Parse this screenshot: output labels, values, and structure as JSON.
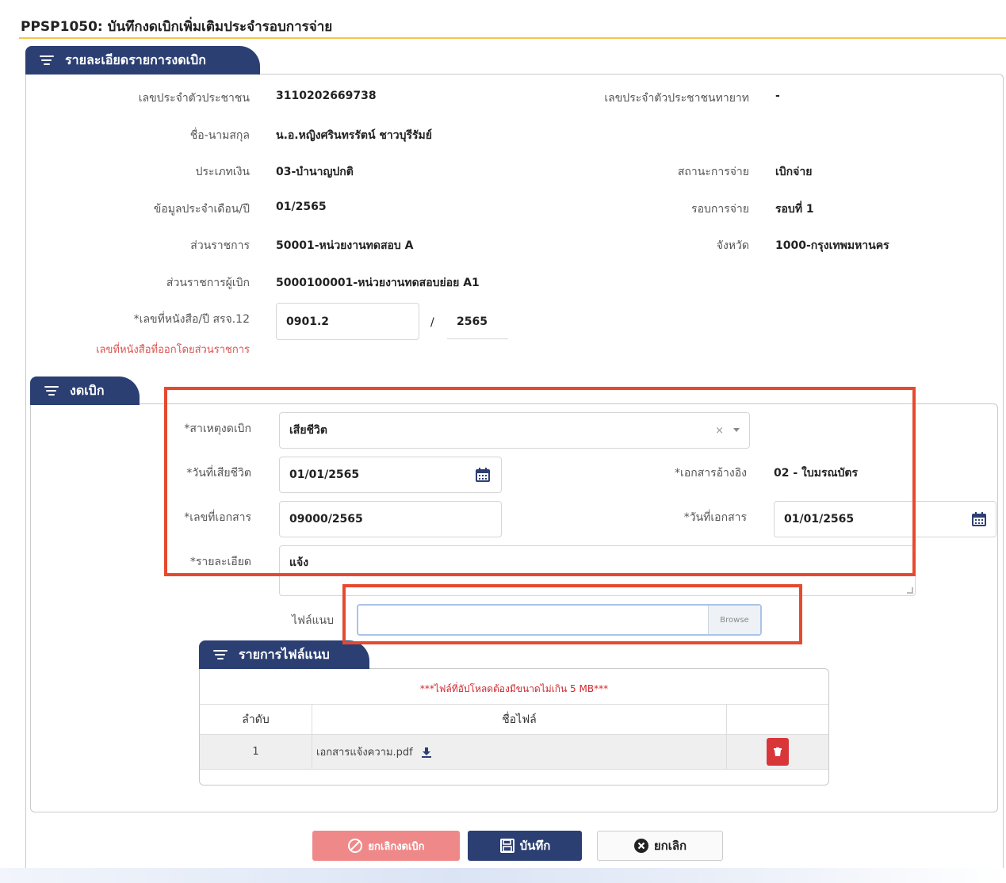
{
  "page": {
    "title": "PPSP1050: บันทึกงดเบิกเพิ่มเติมประจำรอบการจ่าย"
  },
  "details_panel": {
    "tab_label": "รายละเอียดรายการงดเบิก",
    "fields": {
      "citizen_id": {
        "label": "เลขประจำตัวประชาชน",
        "value": "3110202669738"
      },
      "heir_citizen_id": {
        "label": "เลขประจำตัวประชาชนทายาท",
        "value": "-"
      },
      "full_name": {
        "label": "ชื่อ-นามสกุล",
        "value": "น.อ.หญิงศรินทรรัตน์ ชาวบุรีรัมย์"
      },
      "money_type": {
        "label": "ประเภทเงิน",
        "value": "03-บำนาญปกติ"
      },
      "payment_status": {
        "label": "สถานะการจ่าย",
        "value": "เบิกจ่าย"
      },
      "month_year": {
        "label": "ข้อมูลประจำเดือน/ปี",
        "value": "01/2565"
      },
      "payment_round": {
        "label": "รอบการจ่าย",
        "value": "รอบที่ 1"
      },
      "agency": {
        "label": "ส่วนราชการ",
        "value": "50001-หน่วยงานทดสอบ A"
      },
      "province": {
        "label": "จังหวัด",
        "value": "1000-กรุงเทพมหานคร"
      },
      "disbursing_agency": {
        "label": "ส่วนราชการผู้เบิก",
        "value": "5000100001-หน่วยงานทดสอบย่อย A1"
      },
      "letter_no": {
        "label": "*เลขที่หนังสือ/ปี สรจ.12",
        "value": "0901.2",
        "separator": "/",
        "year": "2565"
      },
      "letter_note": "เลขที่หนังสือที่ออกโดยส่วนราชการ"
    }
  },
  "suspend_panel": {
    "tab_label": "งดเบิก",
    "reason": {
      "label": "*สาเหตุงดเบิก",
      "value": "เสียชีวิต",
      "clear": "×"
    },
    "death_date": {
      "label": "*วันที่เสียชีวิต",
      "value": "01/01/2565"
    },
    "ref_doc": {
      "label": "*เอกสารอ้างอิง",
      "value": "02 - ใบมรณบัตร"
    },
    "doc_no": {
      "label": "*เลขที่เอกสาร",
      "value": "09000/2565"
    },
    "doc_date": {
      "label": "*วันที่เอกสาร",
      "value": "01/01/2565"
    },
    "detail": {
      "label": "*รายละเอียด",
      "value": "แจ้ง"
    },
    "attachment": {
      "label": "ไฟล์แนบ",
      "value": "",
      "browse": "Browse"
    }
  },
  "attachments_panel": {
    "tab_label": "รายการไฟล์แนบ",
    "warning": "***ไฟล์ที่อัปโหลดต้องมีขนาดไม่เกิน 5 MB***",
    "columns": [
      "ลำดับ",
      "ชื่อไฟล์",
      ""
    ],
    "rows": [
      {
        "no": "1",
        "filename": "เอกสารแจ้งความ.pdf"
      }
    ]
  },
  "actions": {
    "cancel_suspend": "ยกเลิกงดเบิก",
    "save": "บันทึก",
    "cancel": "ยกเลิก"
  },
  "colors": {
    "navy": "#2b3f73",
    "accent_red": "#e64a2e",
    "title_rule": "#f5c34a",
    "cancel_suspend_bg": "#ee7d7d",
    "delete_bg": "#d9363a"
  }
}
